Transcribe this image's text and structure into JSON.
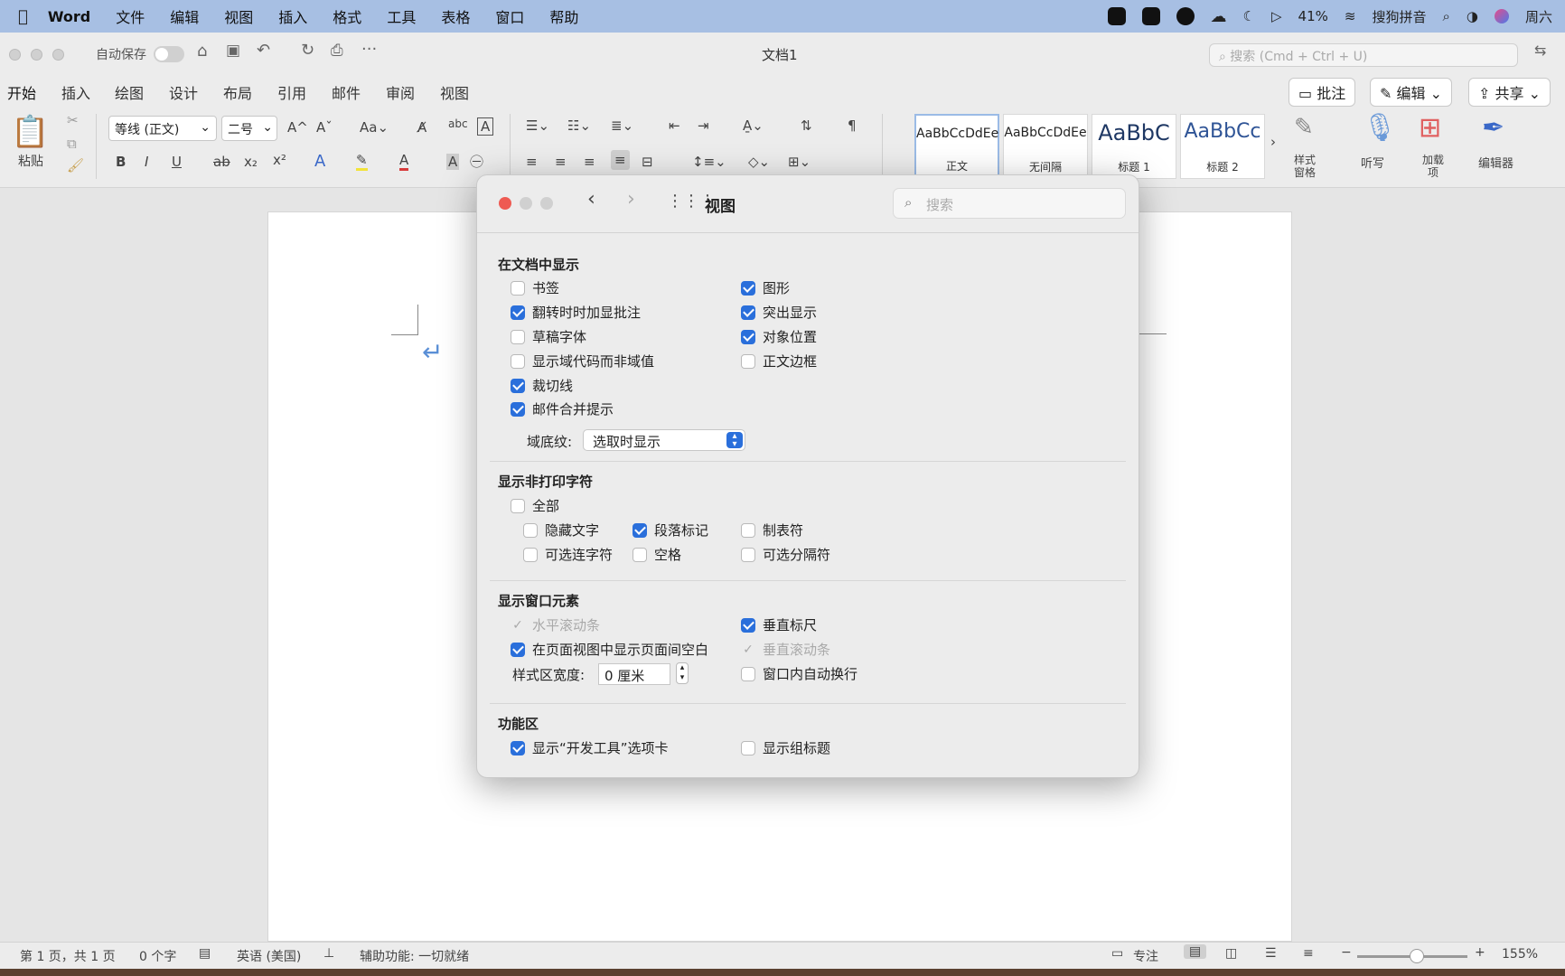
{
  "menubar": {
    "app": "Word",
    "items": [
      "文件",
      "编辑",
      "视图",
      "插入",
      "格式",
      "工具",
      "表格",
      "窗口",
      "帮助"
    ],
    "battery": "41%",
    "ime": "搜狗拼音",
    "day": "周六"
  },
  "titlebar": {
    "autosave_label": "自动保存",
    "doc_title": "文档1",
    "search_placeholder": "搜索 (Cmd + Ctrl + U)"
  },
  "tabs": [
    "开始",
    "插入",
    "绘图",
    "设计",
    "布局",
    "引用",
    "邮件",
    "审阅",
    "视图"
  ],
  "tab_actions": {
    "comment": "批注",
    "edit": "编辑",
    "share": "共享"
  },
  "ribbon": {
    "paste": "粘贴",
    "font": "等线 (正文)",
    "size": "二号",
    "styles": [
      {
        "sample": "AaBbCcDdEe",
        "label": "正文"
      },
      {
        "sample": "AaBbCcDdEe",
        "label": "无间隔"
      },
      {
        "sample": "AaBbC",
        "label": "标题 1"
      },
      {
        "sample": "AaBbCc",
        "label": "标题 2"
      }
    ],
    "styles_pane": "样式\n窗格",
    "dictate": "听写",
    "addins": "加载\n项",
    "editor": "编辑器"
  },
  "dialog": {
    "title": "视图",
    "search_placeholder": "搜索",
    "sections": {
      "show_in_doc": "在文档中显示",
      "nonprint": "显示非打印字符",
      "window": "显示窗口元素",
      "ribbon": "功能区"
    },
    "show_in_doc": {
      "bookmarks": "书签",
      "comments_rollover": "翻转时时加显批注",
      "draft_font": "草稿字体",
      "field_codes": "显示域代码而非域值",
      "crop_marks": "裁切线",
      "mail_merge": "邮件合并提示",
      "drawings": "图形",
      "highlight": "突出显示",
      "object_anchors": "对象位置",
      "text_boundaries": "正文边框",
      "field_shading_label": "域底纹:",
      "field_shading_value": "选取时显示"
    },
    "nonprint": {
      "all": "全部",
      "hidden_text": "隐藏文字",
      "paragraph_marks": "段落标记",
      "tabs": "制表符",
      "optional_hyphens": "可选连字符",
      "spaces": "空格",
      "optional_breaks": "可选分隔符"
    },
    "window": {
      "h_scroll": "水平滚动条",
      "white_space": "在页面视图中显示页面间空白",
      "style_area_label": "样式区宽度:",
      "style_area_value": "0 厘米",
      "v_ruler": "垂直标尺",
      "v_scroll": "垂直滚动条",
      "wrap": "窗口内自动换行"
    },
    "ribbon": {
      "developer": "显示“开发工具”选项卡",
      "group_titles": "显示组标题"
    }
  },
  "statusbar": {
    "page": "第 1 页，共 1 页",
    "words": "0 个字",
    "language": "英语 (美国)",
    "accessibility": "辅助功能: 一切就绪",
    "focus": "专注",
    "zoom": "155%"
  }
}
